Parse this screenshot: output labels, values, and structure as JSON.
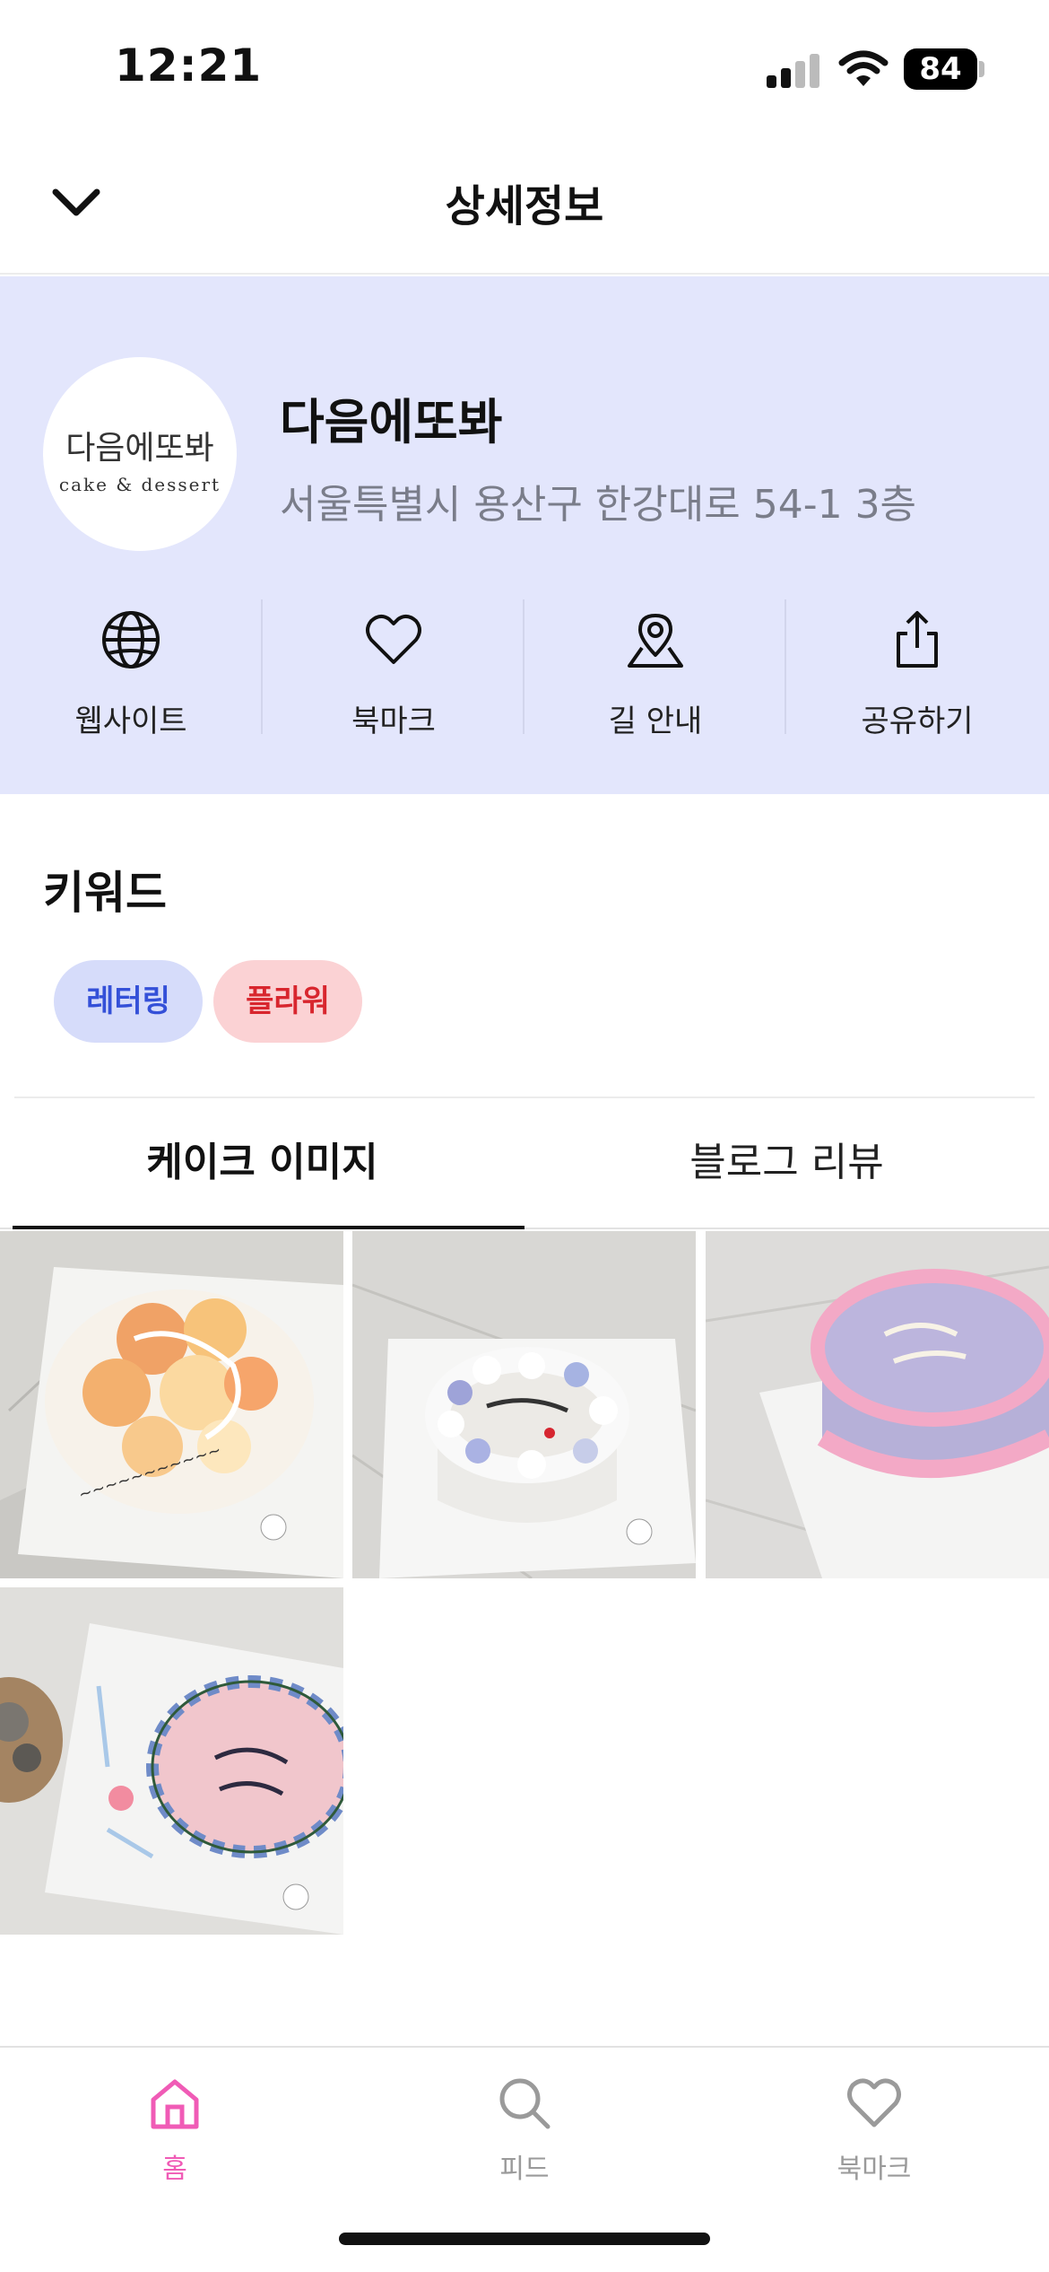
{
  "status_bar": {
    "time": "12:21",
    "battery": "84"
  },
  "header": {
    "title": "상세정보",
    "back_icon": "chevron-down-icon"
  },
  "store": {
    "name": "다음에또봐",
    "address": "서울특별시 용산구 한강대로 54-1 3층",
    "logo_text_ko": "다음에또봐",
    "logo_text_en": "cake & dessert",
    "panel_color": "#e3e6fc"
  },
  "actions": [
    {
      "label": "웹사이트",
      "icon": "globe-icon"
    },
    {
      "label": "북마크",
      "icon": "heart-icon"
    },
    {
      "label": "길 안내",
      "icon": "map-pin-icon"
    },
    {
      "label": "공유하기",
      "icon": "share-icon"
    }
  ],
  "keywords": {
    "title": "키워드",
    "chips": [
      {
        "label": "레터링",
        "color": "#3450d8",
        "bg": "#d6dcfa"
      },
      {
        "label": "플라워",
        "color": "#d8262e",
        "bg": "#fbd2d4"
      }
    ]
  },
  "tabs": [
    {
      "label": "케이크 이미지",
      "active": true
    },
    {
      "label": "블로그 리뷰",
      "active": false
    }
  ],
  "images": [
    {
      "name": "cake-image-1",
      "icing": "Happy Birthday",
      "description": "orange and yellow palette-style cake"
    },
    {
      "name": "cake-image-2",
      "icing": "Happy Birthday",
      "description": "white flower wreath cake"
    },
    {
      "name": "cake-image-3",
      "icing": "happy 559 day!",
      "description": "lavender cake with pink piping"
    },
    {
      "name": "cake-image-4",
      "icing": "Happy 35 Day!",
      "description": "pink cake with blue flower wreath"
    }
  ],
  "bottom_nav": [
    {
      "label": "홈",
      "icon": "home-icon",
      "active": true
    },
    {
      "label": "피드",
      "icon": "search-icon",
      "active": false
    },
    {
      "label": "북마크",
      "icon": "heart-icon",
      "active": false
    }
  ],
  "colors": {
    "accent": "#f05bb6",
    "inactive": "#9a9a9a"
  }
}
